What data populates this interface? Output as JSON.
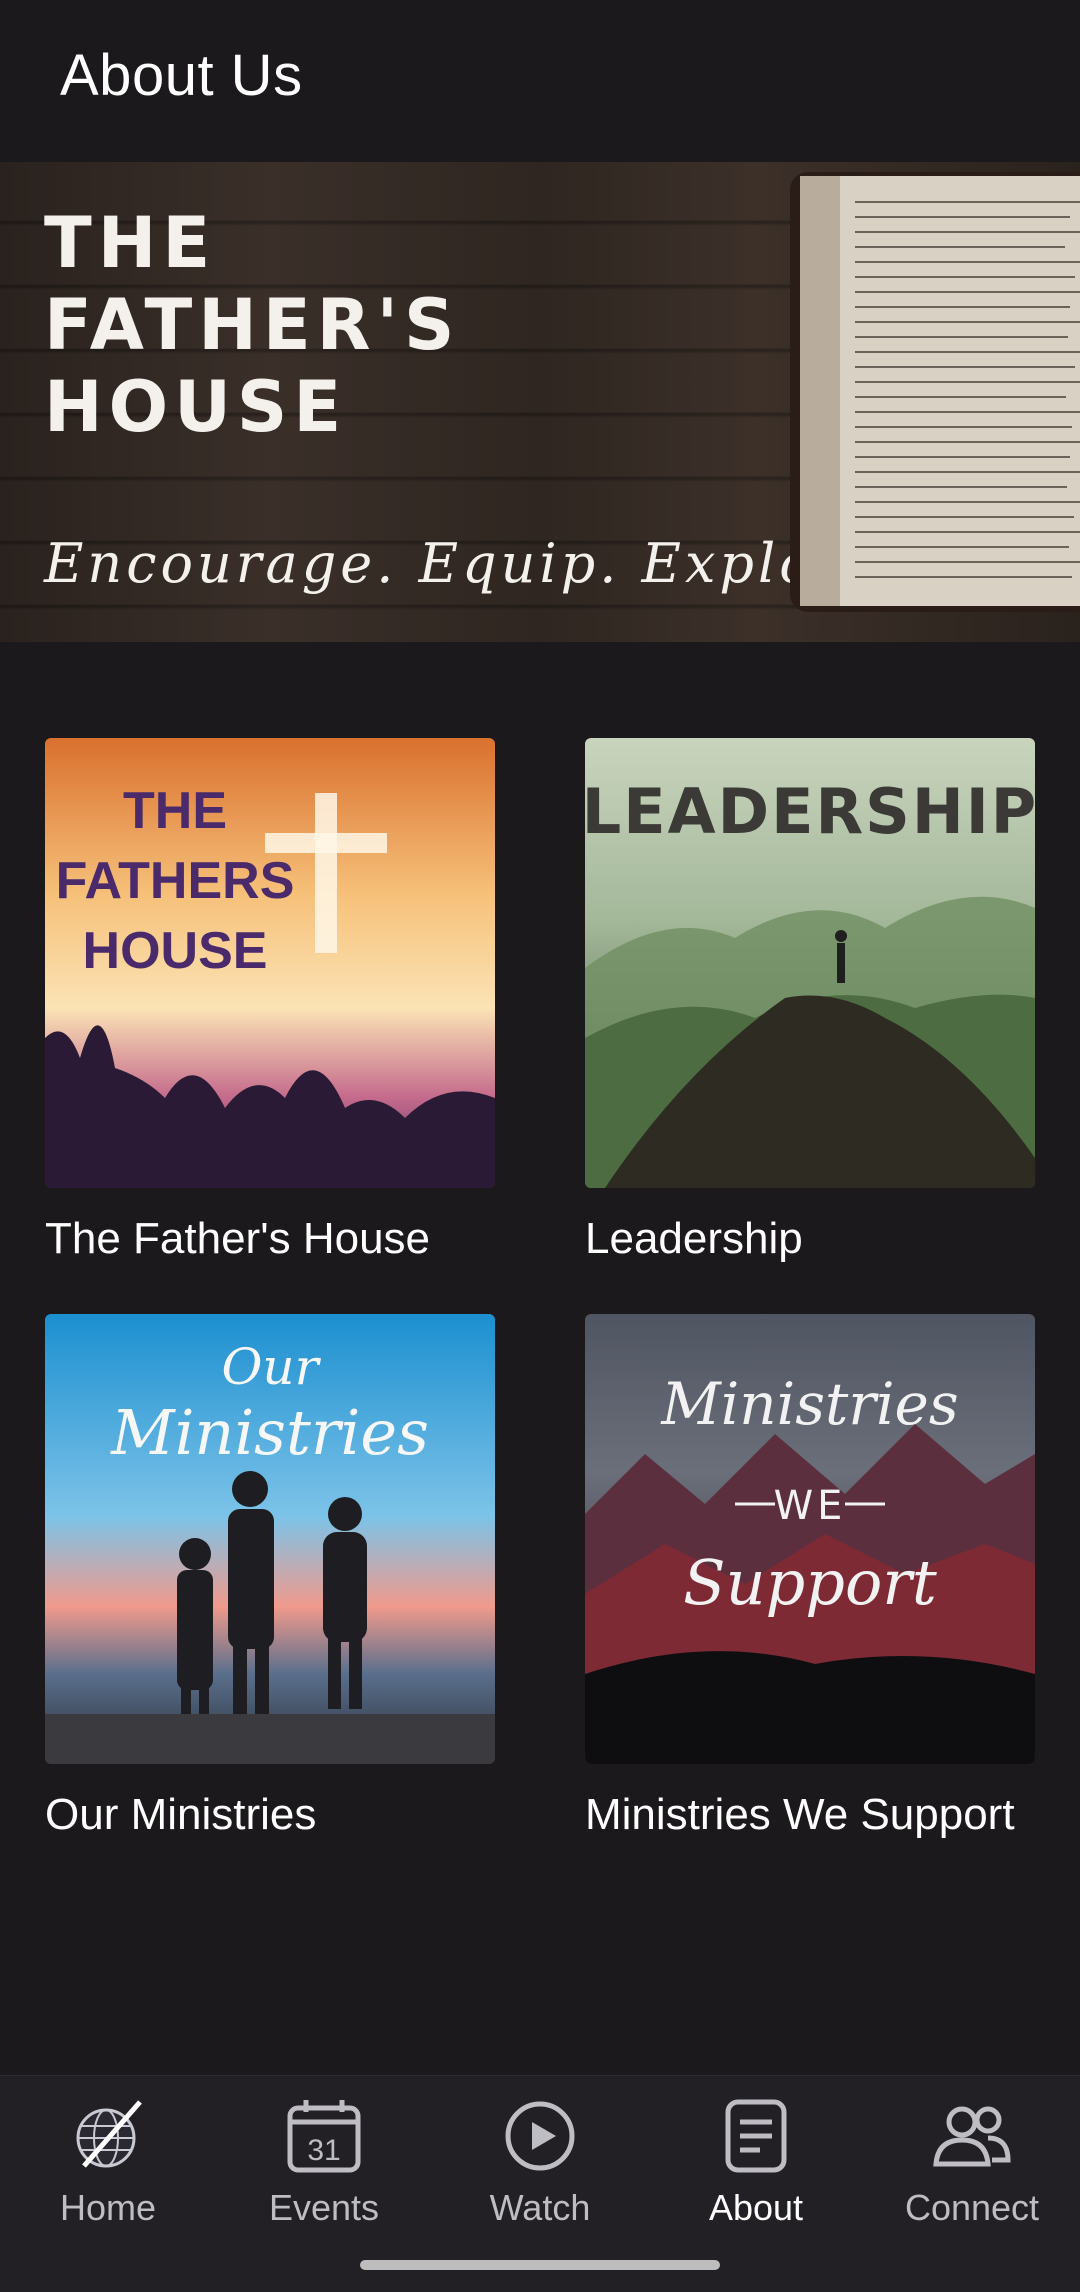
{
  "header": {
    "title": "About Us"
  },
  "banner": {
    "title_lines": [
      "THE",
      "FATHER'S",
      "HOUSE"
    ],
    "tagline": "Encourage. Equip. Explore."
  },
  "cards": [
    {
      "label": "The Father's House",
      "image_text": [
        "THE",
        "FATHERS",
        "HOUSE"
      ]
    },
    {
      "label": "Leadership",
      "image_text": [
        "LEADERSHIP"
      ]
    },
    {
      "label": "Our Ministries",
      "image_text": [
        "Our",
        "Ministries"
      ]
    },
    {
      "label": "Ministries We Support",
      "image_text": [
        "Ministries",
        "WE",
        "Support"
      ]
    }
  ],
  "tabs": [
    {
      "label": "Home",
      "icon": "globe-logo-icon",
      "active": false
    },
    {
      "label": "Events",
      "icon": "calendar-icon",
      "badge": "31",
      "active": false
    },
    {
      "label": "Watch",
      "icon": "play-circle-icon",
      "active": false
    },
    {
      "label": "About",
      "icon": "document-icon",
      "active": true
    },
    {
      "label": "Connect",
      "icon": "people-icon",
      "active": false
    }
  ],
  "colors": {
    "background": "#1b191b",
    "tabbar": "#222024",
    "inactive": "#bdbdc3",
    "active": "#ffffff"
  }
}
